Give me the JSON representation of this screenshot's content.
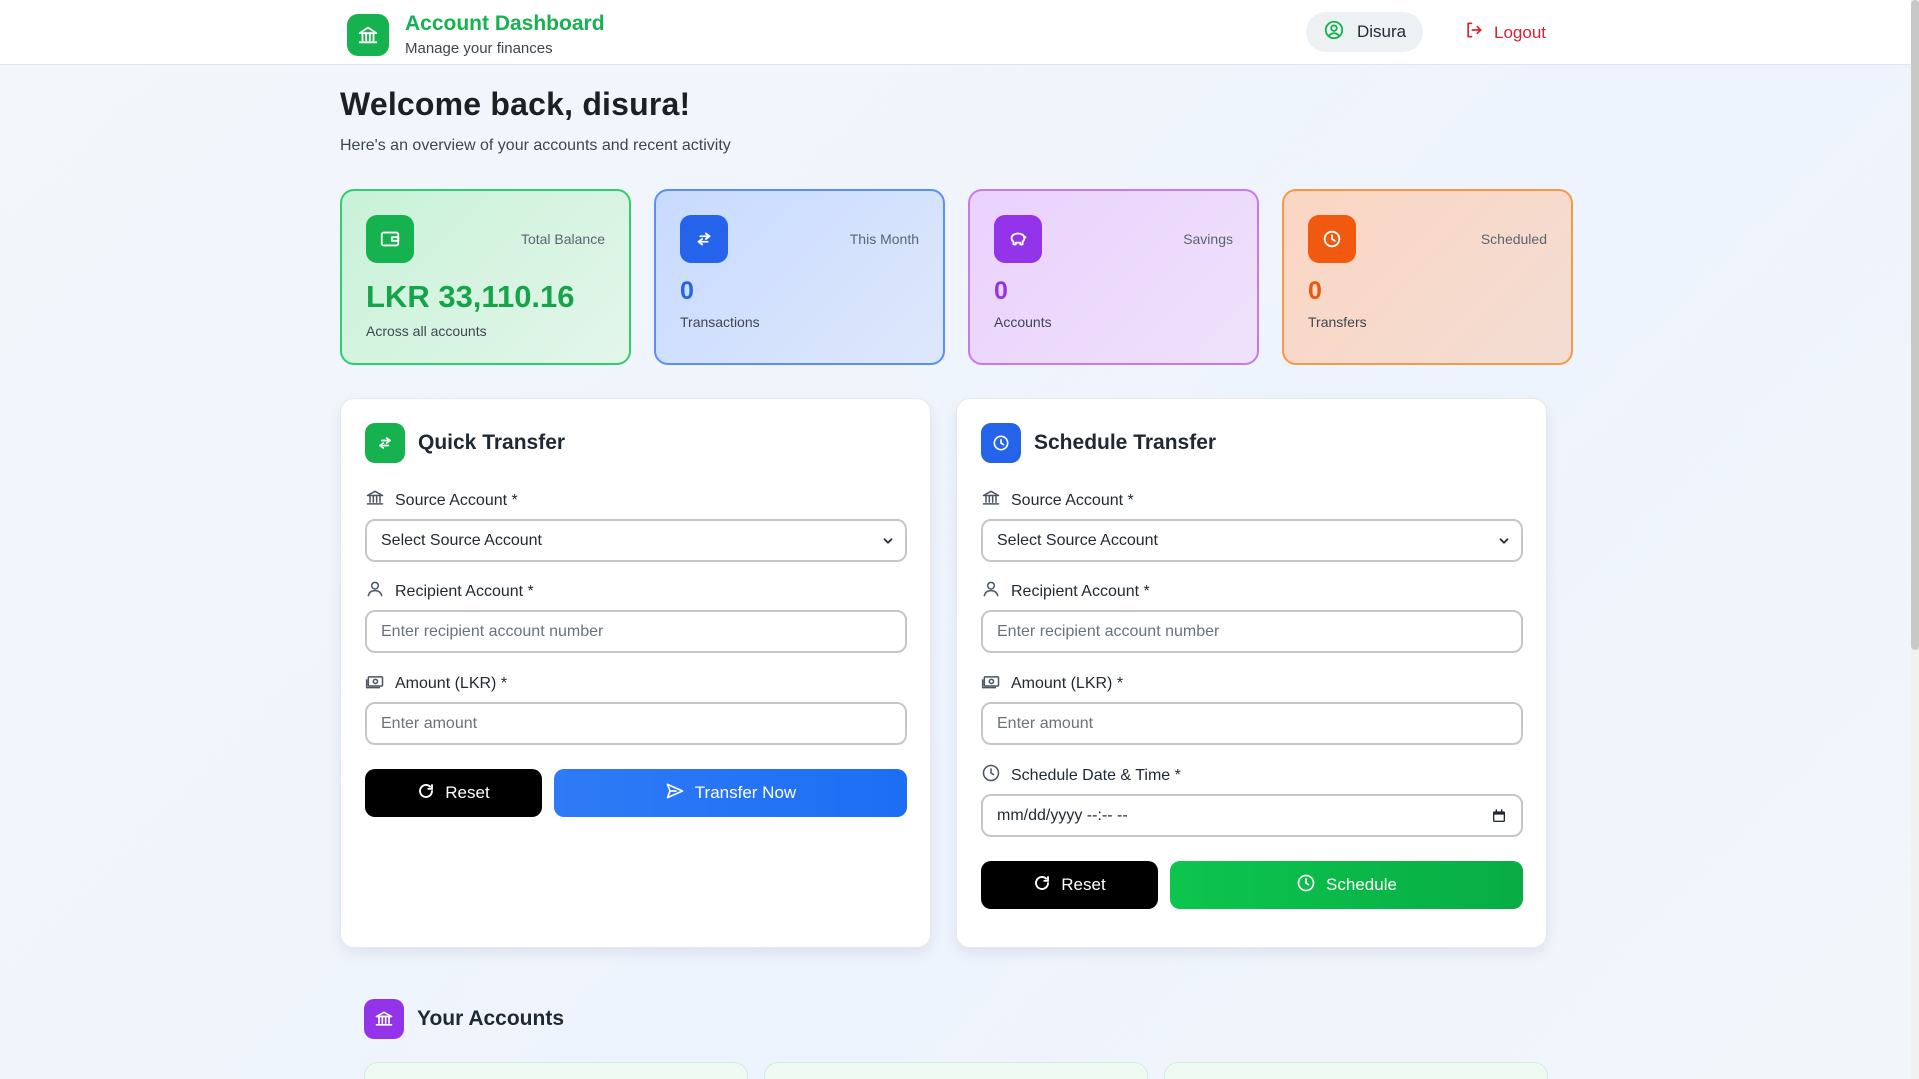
{
  "header": {
    "title": "Account Dashboard",
    "subtitle": "Manage your finances",
    "user_name": "Disura",
    "logout_label": "Logout"
  },
  "welcome": {
    "heading": "Welcome back, disura!",
    "subtext": "Here's an overview of your accounts and recent activity"
  },
  "stats": [
    {
      "label": "Total Balance",
      "value": "LKR 33,110.16",
      "sub": "Across all accounts",
      "color": "#16a34a"
    },
    {
      "label": "This Month",
      "value": "0",
      "sub": "Transactions",
      "color": "#2563eb"
    },
    {
      "label": "Savings",
      "value": "0",
      "sub": "Accounts",
      "color": "#9333ea"
    },
    {
      "label": "Scheduled",
      "value": "0",
      "sub": "Transfers",
      "color": "#ea580c"
    }
  ],
  "quick_transfer": {
    "title": "Quick Transfer",
    "source_label": "Source Account *",
    "source_value": "Select Source Account",
    "recipient_label": "Recipient Account *",
    "recipient_placeholder": "Enter recipient account number",
    "amount_label": "Amount (LKR) *",
    "amount_placeholder": "Enter amount",
    "reset_label": "Reset",
    "submit_label": "Transfer Now"
  },
  "schedule_transfer": {
    "title": "Schedule Transfer",
    "source_label": "Source Account *",
    "source_value": "Select Source Account",
    "recipient_label": "Recipient Account *",
    "recipient_placeholder": "Enter recipient account number",
    "amount_label": "Amount (LKR) *",
    "amount_placeholder": "Enter amount",
    "datetime_label": "Schedule Date & Time *",
    "datetime_placeholder": "mm/dd/yyyy --:-- --",
    "reset_label": "Reset",
    "submit_label": "Schedule"
  },
  "accounts_section": {
    "title": "Your Accounts"
  },
  "colors": {
    "brand_green": "#16b24f",
    "transfer_blue": "#2f7bf6",
    "schedule_green": "#0cc54e",
    "logout_red": "#e0202f"
  }
}
